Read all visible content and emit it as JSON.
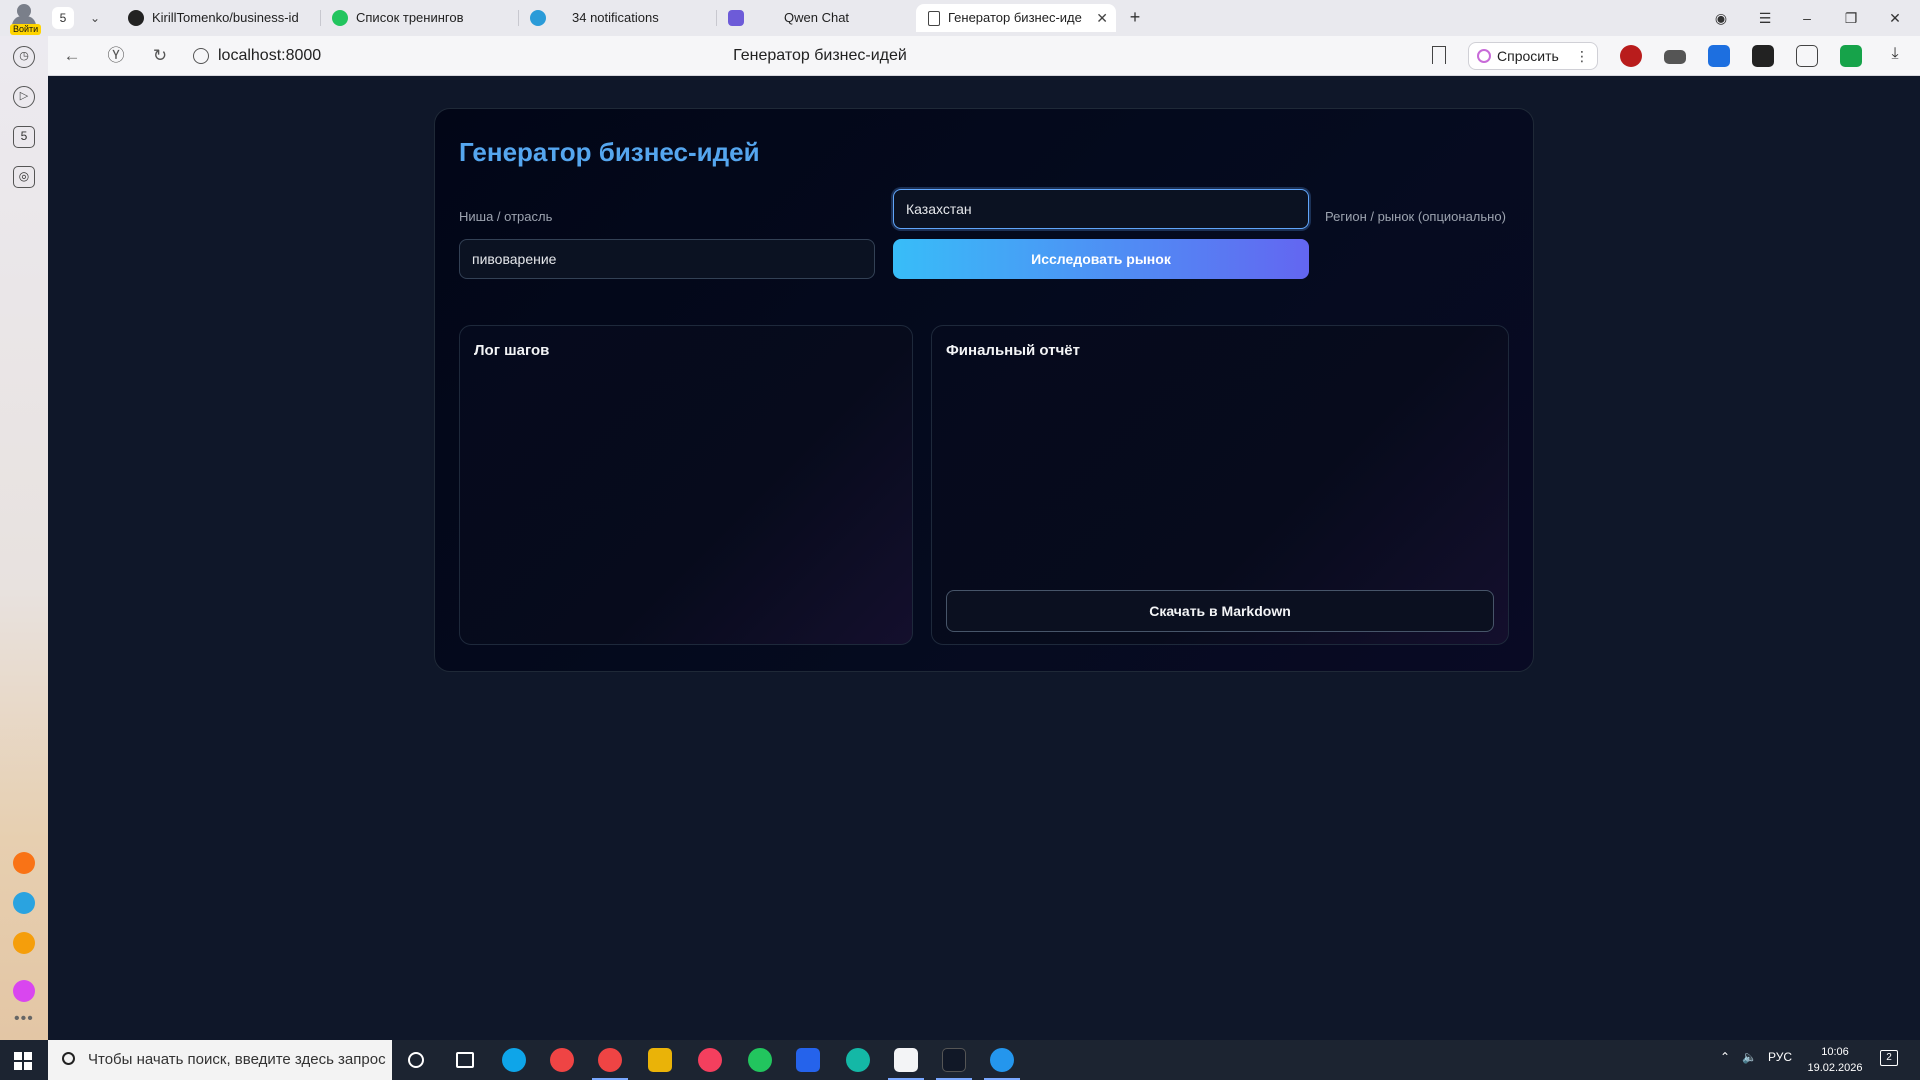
{
  "browser": {
    "profile_badge": "Войти",
    "tab_count": "5",
    "tabs": [
      {
        "title": "KirillTomenko/business-id",
        "icon": "github-icon"
      },
      {
        "title": "Список тренингов",
        "icon": "green-circle-icon"
      },
      {
        "title": "34 notifications",
        "icon": "telegram-icon"
      },
      {
        "title": "Qwen Chat",
        "icon": "qwen-icon"
      },
      {
        "title": "Генератор бизнес-иде",
        "icon": "document-icon",
        "active": true
      }
    ],
    "url": "localhost:8000",
    "page_title": "Генератор бизнес-идей",
    "ask_label": "Спросить",
    "rail_tab_count": "5"
  },
  "app": {
    "title": "Генератор бизнес-идей",
    "niche_label": "Ниша / отрасль",
    "niche_value": "пивоварение",
    "region_label": "Регион / рынок (опционально)",
    "region_value": "Казахстан",
    "research_button": "Исследовать рынок",
    "log_title": "Лог шагов",
    "report_title": "Финальный отчёт",
    "download_button": "Скачать в Markdown"
  },
  "taskbar": {
    "search_placeholder": "Чтобы начать поиск, введите здесь запрос",
    "language": "РУС",
    "time": "10:06",
    "date": "19.02.2026",
    "notifications": "2"
  },
  "colors": {
    "accent_title": "#55a6ef",
    "button_gradient_start": "#38bdf8",
    "button_gradient_end": "#6366f1",
    "page_background": "#0f1729"
  }
}
